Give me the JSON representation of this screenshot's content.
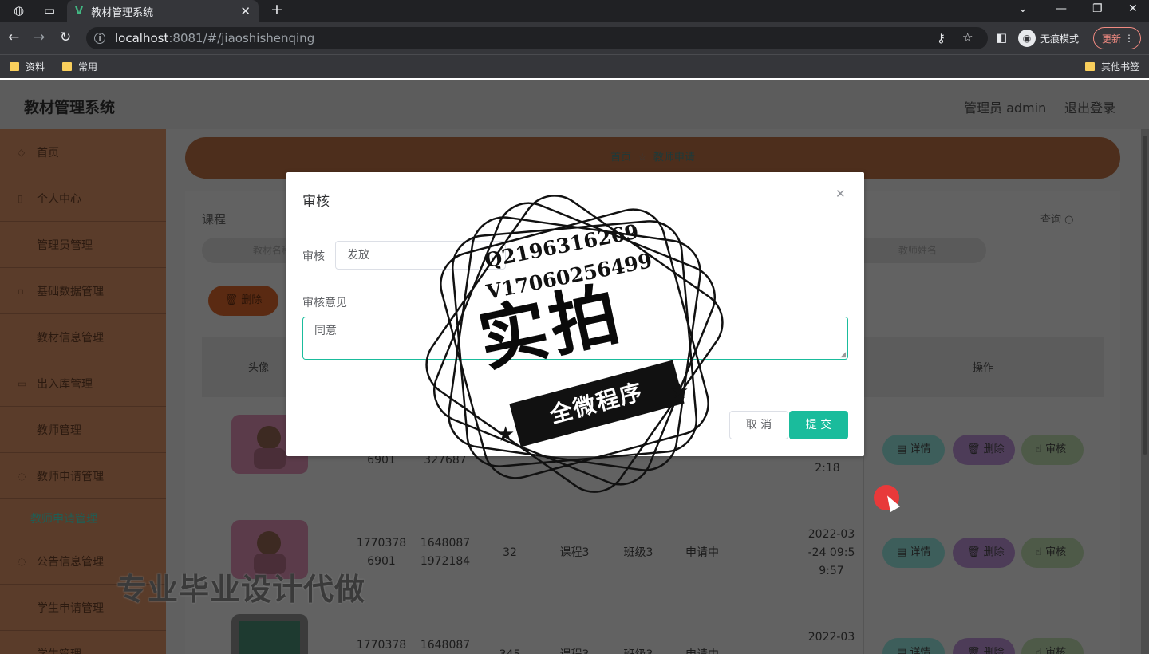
{
  "browser": {
    "tab_title": "教材管理系统",
    "url_host": "localhost",
    "url_path": ":8081/#/jiaoshishenqing",
    "incognito_label": "无痕模式",
    "update_label": "更新",
    "bookmarks": [
      "资料",
      "常用"
    ],
    "other_bookmarks": "其他书签"
  },
  "header": {
    "title": "教材管理系统",
    "user": "管理员 admin",
    "logout": "退出登录"
  },
  "sidebar": {
    "items": [
      "首页",
      "个人中心",
      "管理员管理",
      "基础数据管理",
      "教材信息管理",
      "出入库管理",
      "教师管理",
      "教师申请管理",
      "公告信息管理",
      "学生申请管理",
      "学生管理"
    ],
    "active_sub": "教师申请管理"
  },
  "breadcrumb": {
    "home": "首页",
    "current": "教师申请"
  },
  "panel": {
    "label": "课程",
    "query": "查询",
    "search_left": "教材名称",
    "search_right": "教师姓名",
    "delete_button": "删除"
  },
  "table": {
    "headers": {
      "avatar": "头像",
      "actions": "操作"
    },
    "rows": [
      {
        "phone": "6901",
        "id": "327687",
        "qty": "",
        "course": "",
        "class": "",
        "status": "",
        "time": "2:18"
      },
      {
        "phone": "1770378\n6901",
        "id": "1648087\n1972184",
        "qty": "32",
        "course": "课程3",
        "class": "班级3",
        "status": "申请中",
        "time": "2022-03\n-24 09:5\n9:57"
      },
      {
        "phone": "1770378",
        "id": "1648087",
        "qty": "345",
        "course": "课程3",
        "class": "班级3",
        "status": "申请中",
        "time": "2022-03"
      }
    ],
    "action_labels": {
      "detail": "详情",
      "remove": "删除",
      "audit": "审核"
    }
  },
  "dialog": {
    "title": "审核",
    "audit_label": "审核",
    "audit_value": "发放",
    "opinion_label": "审核意见",
    "opinion_value": "同意",
    "cancel": "取 消",
    "submit": "提 交"
  },
  "stamp": {
    "qq": "Q2196316269",
    "wechat": "V17060256499",
    "big": "实拍",
    "band": "全微程序"
  },
  "watermark": "专业毕业设计代做"
}
